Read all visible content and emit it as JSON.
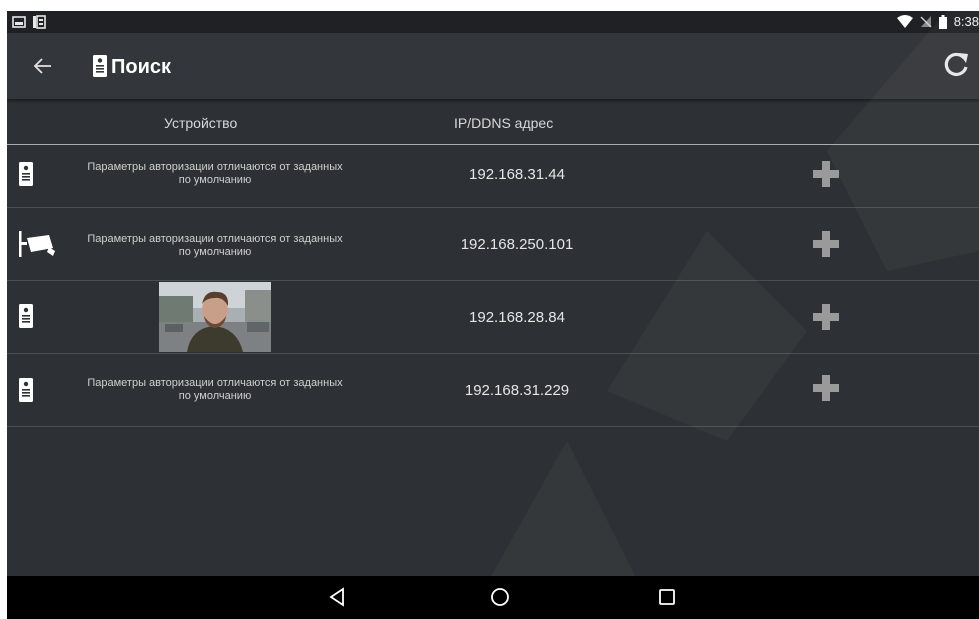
{
  "status_bar": {
    "time": "8:38",
    "left_icons": [
      "image-notification-icon",
      "sim-card-icon"
    ],
    "right_icons": [
      "wifi-icon",
      "no-signal-icon",
      "battery-icon"
    ]
  },
  "app_bar": {
    "title": "Поиск",
    "back_icon": "arrow-left-icon",
    "title_icon": "intercom-panel-icon",
    "refresh_icon": "refresh-icon"
  },
  "table": {
    "headers": [
      "Устройство",
      "IP/DDNS адрес"
    ],
    "rows": [
      {
        "device_icon": "intercom-panel-icon",
        "message_line1": "Параметры авторизации отличаются от заданных",
        "message_line2": "по умолчанию",
        "ip": "192.168.31.44",
        "action_icon": "add-icon"
      },
      {
        "device_icon": "camera-icon",
        "message_line1": "Параметры авторизации отличаются от заданных",
        "message_line2": "по умолчанию",
        "ip": "192.168.250.101",
        "action_icon": "add-icon"
      },
      {
        "device_icon": "intercom-panel-icon",
        "preview": "camera-snapshot",
        "ip": "192.168.28.84",
        "action_icon": "add-icon"
      },
      {
        "device_icon": "intercom-panel-icon",
        "message_line1": "Параметры авторизации отличаются от заданных",
        "message_line2": "по умолчанию",
        "ip": "192.168.31.229",
        "action_icon": "add-icon"
      }
    ]
  },
  "nav_bar": {
    "buttons": [
      "back-triangle-icon",
      "home-circle-icon",
      "recents-square-icon"
    ]
  },
  "colors": {
    "background": "#2d3034",
    "app_bar": "#33363a",
    "status_bar": "#1f2124",
    "nav_bar": "#000000",
    "add_icon": "#9a9a9a"
  }
}
